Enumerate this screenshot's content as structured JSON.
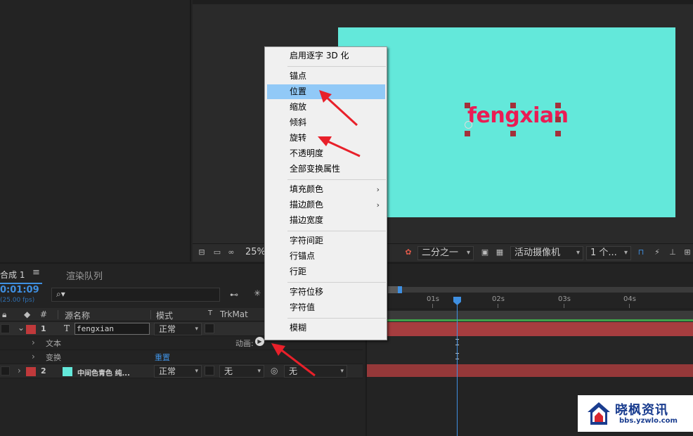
{
  "viewer": {
    "canvas_color": "#63e8da",
    "layer_text": "fengxian",
    "text_color": "#ea1c54",
    "toolbar": {
      "zoom": "25%",
      "resolution": "二分之一",
      "camera": "活动摄像机",
      "views": "1 个..."
    }
  },
  "timeline": {
    "tabs": {
      "comp": "合成 1",
      "comp_menu": "≡",
      "render": "渲染队列"
    },
    "timecode": "0:01:09",
    "fps": "(25.00 fps)",
    "search_placeholder": "",
    "headers": {
      "num": "#",
      "source_name": "源名称",
      "mode": "模式",
      "t": "T",
      "trkmat": "TrkMat"
    },
    "layers": [
      {
        "num": "1",
        "type_icon": "T",
        "name": "fengxian",
        "mode": "正常",
        "label_color": "#c0393b"
      },
      {
        "num": "2",
        "name": "中间色青色 纯...",
        "mode": "正常",
        "trkmat": "无",
        "parent": "无",
        "label_color": "#c0393b",
        "swatch": "#63e8da"
      }
    ],
    "sub_rows": {
      "text": "文本",
      "animate_label": "动画:",
      "transform": "变换",
      "reset": "重置"
    },
    "ruler": [
      "01s",
      "02s",
      "03s",
      "04s"
    ],
    "accent": "#3f90e2",
    "track_color": "#a63d3f"
  },
  "context_menu": {
    "items": [
      {
        "label": "启用逐字 3D 化"
      },
      {
        "label": "锚点"
      },
      {
        "label": "位置",
        "highlight": true
      },
      {
        "label": "缩放"
      },
      {
        "label": "倾斜"
      },
      {
        "label": "旋转"
      },
      {
        "label": "不透明度"
      },
      {
        "label": "全部变换属性"
      },
      {
        "label": "填充颜色",
        "submenu": true
      },
      {
        "label": "描边颜色",
        "submenu": true
      },
      {
        "label": "描边宽度"
      },
      {
        "label": "字符间距"
      },
      {
        "label": "行锚点"
      },
      {
        "label": "行距"
      },
      {
        "label": "字符位移"
      },
      {
        "label": "字符值"
      },
      {
        "label": "模糊"
      }
    ]
  },
  "watermark": {
    "title": "晓枫资讯",
    "url": "bbs.yzwlo.com"
  }
}
